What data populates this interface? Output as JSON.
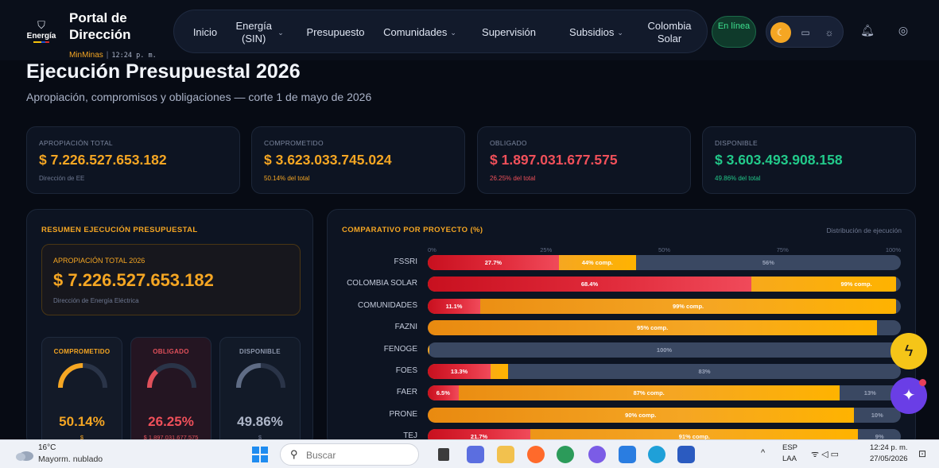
{
  "header": {
    "brand": {
      "logo_word": "Energía",
      "title_line1": "Portal de",
      "title_line2": "Dirección",
      "org": "MinMinas",
      "time": "12:24 p. m."
    },
    "nav": [
      {
        "label": "Inicio",
        "dropdown": false
      },
      {
        "label": "Energía (SIN)",
        "dropdown": true
      },
      {
        "label": "Presupuesto",
        "dropdown": false
      },
      {
        "label": "Comunidades",
        "dropdown": true
      },
      {
        "label": "Supervisión",
        "dropdown": false
      },
      {
        "label": "Subsidios",
        "dropdown": true
      },
      {
        "label": "Colombia Solar",
        "dropdown": false
      }
    ],
    "status": "En línea",
    "theme_buttons": [
      "moon-icon",
      "monitor-icon",
      "sun-icon"
    ],
    "icons": [
      "bell-icon",
      "user-icon"
    ]
  },
  "page": {
    "title": "Ejecución Presupuestal 2026",
    "subtitle": "Apropiación, compromisos y obligaciones — corte 1 de mayo de 2026"
  },
  "kpis": [
    {
      "label": "APROPIACIÓN TOTAL",
      "value": "$ 7.226.527.653.182",
      "note": "Dirección de EE",
      "color": "#f5a623",
      "note_color": "#6e7891"
    },
    {
      "label": "COMPROMETIDO",
      "value": "$ 3.623.033.745.024",
      "note": "50.14% del total",
      "color": "#f5a623",
      "note_color": "#f5a623"
    },
    {
      "label": "OBLIGADO",
      "value": "$ 1.897.031.677.575",
      "note": "26.25% del total",
      "color": "#f0505a",
      "note_color": "#f0505a"
    },
    {
      "label": "DISPONIBLE",
      "value": "$ 3.603.493.908.158",
      "note": "49.86% del total",
      "color": "#22c98a",
      "note_color": "#22c98a"
    }
  ],
  "summary": {
    "heading": "RESUMEN EJECUCIÓN PRESUPUESTAL",
    "approp_label": "APROPIACIÓN TOTAL 2026",
    "approp_value": "$ 7.226.527.653.182",
    "approp_note": "Dirección de Energía Eléctrica",
    "gauges": [
      {
        "label": "COMPROMETIDO",
        "percent_text": "50.14%",
        "fraction": 0.5014,
        "sub": "$",
        "color": "#f5a623",
        "bg": "#131a28",
        "label_color": "#f5a623",
        "pct_color": "#f5a623",
        "sub_color": "#f5a623"
      },
      {
        "label": "OBLIGADO",
        "percent_text": "26.25%",
        "fraction": 0.2625,
        "sub": "$ 1.897.031.677.575",
        "color": "#e0505a",
        "bg": "#241522",
        "label_color": "#e0505a",
        "pct_color": "#f0505a",
        "sub_color": "#e0505a"
      },
      {
        "label": "DISPONIBLE",
        "percent_text": "49.86%",
        "fraction": 0.4986,
        "sub": "$",
        "color": "#5f6c85",
        "bg": "#121a28",
        "label_color": "#8c96ab",
        "pct_color": "#aeb6c8",
        "sub_color": "#6e7891"
      }
    ]
  },
  "comparativo": {
    "heading": "COMPARATIVO POR PROYECTO (%)",
    "note": "Distribución de ejecución"
  },
  "chart_data": {
    "type": "bar",
    "orientation": "horizontal",
    "stacked": true,
    "xlim": [
      0,
      100
    ],
    "x_ticks": [
      "0%",
      "25%",
      "50%",
      "75%",
      "100%"
    ],
    "grid": false,
    "categories": [
      "FSSRI",
      "COLOMBIA SOLAR",
      "COMUNIDADES",
      "FAZNI",
      "FENOGE",
      "FOES",
      "FAER",
      "PRONE",
      "TEJ"
    ],
    "rows": [
      {
        "name": "FSSRI",
        "obligado": 27.7,
        "comprometido": 44,
        "obl_label": "27.7%",
        "comp_label": "44% comp.",
        "rem_label": "56%"
      },
      {
        "name": "COLOMBIA SOLAR",
        "obligado": 68.4,
        "comprometido": 99,
        "obl_label": "68.4%",
        "comp_label": "99% comp.",
        "rem_label": ""
      },
      {
        "name": "COMUNIDADES",
        "obligado": 11.1,
        "comprometido": 99,
        "obl_label": "11.1%",
        "comp_label": "99% comp.",
        "rem_label": ""
      },
      {
        "name": "FAZNI",
        "obligado": 0,
        "comprometido": 95,
        "obl_label": "",
        "comp_label": "95% comp.",
        "rem_label": ""
      },
      {
        "name": "FENOGE",
        "obligado": 0,
        "comprometido": 0,
        "obl_label": "",
        "comp_label": "",
        "rem_label": "100%"
      },
      {
        "name": "FOES",
        "obligado": 13.3,
        "comprometido": 17,
        "obl_label": "13.3%",
        "comp_label": "",
        "rem_label": "83%"
      },
      {
        "name": "FAER",
        "obligado": 6.5,
        "comprometido": 87,
        "obl_label": "6.5%",
        "comp_label": "87% comp.",
        "rem_label": "13%"
      },
      {
        "name": "PRONE",
        "obligado": 0,
        "comprometido": 90,
        "obl_label": "",
        "comp_label": "90% comp.",
        "rem_label": "10%"
      },
      {
        "name": "TEJ",
        "obligado": 21.7,
        "comprometido": 91,
        "obl_label": "21.7%",
        "comp_label": "91% comp.",
        "rem_label": "9%"
      }
    ],
    "colors": {
      "obligado": "#e02a3a",
      "comprometido": "#f5a623",
      "remaining": "#3a4862"
    }
  },
  "taskbar": {
    "weather_temp": "16°C",
    "weather_desc": "Mayorm. nublado",
    "search_placeholder": "Buscar",
    "lang_line1": "ESP",
    "lang_line2": "LAA",
    "clock_time": "12:24 p. m.",
    "clock_date": "27/05/2026"
  }
}
